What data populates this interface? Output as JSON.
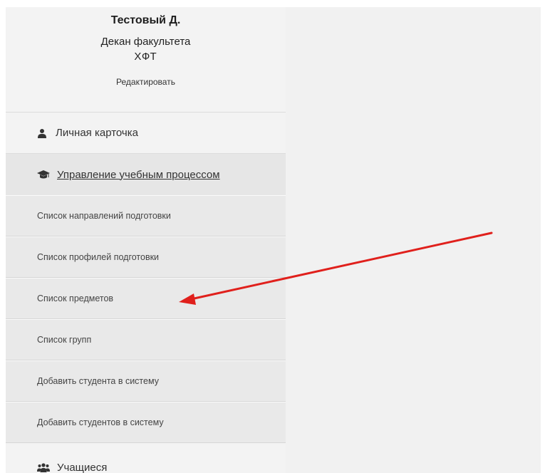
{
  "profile": {
    "name": "Тестовый Д.",
    "role": "Декан факультета",
    "faculty": "ХФТ",
    "edit_label": "Редактировать"
  },
  "nav": {
    "personal_card": {
      "label": "Личная карточка",
      "icon": "user-icon"
    },
    "management": {
      "label": "Управление учебным процессом",
      "icon": "graduation-cap-icon"
    },
    "submenu": [
      {
        "label": "Список направлений подготовки"
      },
      {
        "label": "Список профилей подготовки"
      },
      {
        "label": "Список предметов"
      },
      {
        "label": "Список групп"
      },
      {
        "label": "Добавить студента в систему"
      },
      {
        "label": "Добавить студентов в систему"
      }
    ],
    "students": {
      "label": "Учащиеся",
      "icon": "users-icon"
    }
  },
  "annotation": {
    "arrow_color": "#e0201c",
    "arrow_points_to": "Список предметов"
  }
}
